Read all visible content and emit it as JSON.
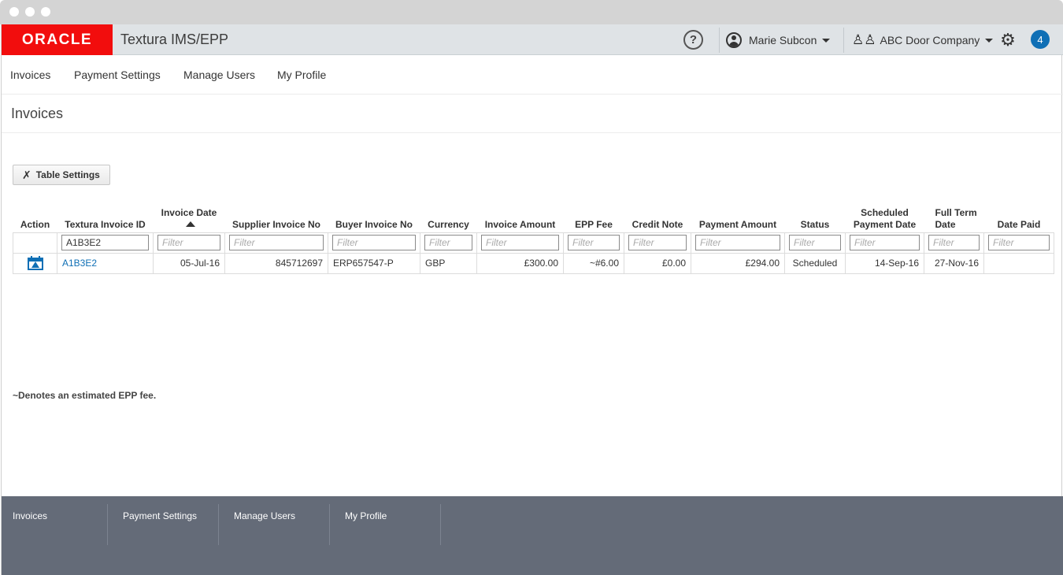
{
  "brand": {
    "logo_text": "ORACLE",
    "app_title": "Textura IMS/EPP",
    "help_label": "?",
    "user_name": "Marie Subcon",
    "company_name": "ABC Door Company",
    "notification_count": "4",
    "brand_color": "#f20d0d"
  },
  "topnav": {
    "items": [
      {
        "label": "Invoices"
      },
      {
        "label": "Payment Settings"
      },
      {
        "label": "Manage Users"
      },
      {
        "label": "My Profile"
      }
    ]
  },
  "page": {
    "title": "Invoices",
    "table_settings_label": "Table Settings"
  },
  "table": {
    "headers": {
      "action": "Action",
      "invoice_id": "Textura Invoice ID",
      "invoice_date": "Invoice Date",
      "supplier_no": "Supplier Invoice No",
      "buyer_no": "Buyer Invoice No",
      "currency": "Currency",
      "invoice_amount": "Invoice Amount",
      "epp_fee": "EPP Fee",
      "credit_note": "Credit Note",
      "payment_amount": "Payment Amount",
      "status": "Status",
      "scheduled_line1": "Scheduled",
      "scheduled_line2": "Payment Date",
      "fullterm_line1": "Full Term",
      "fullterm_line2": "Date",
      "date_paid": "Date Paid"
    },
    "sort": {
      "column": "Invoice Date",
      "direction": "ascending"
    },
    "filters": {
      "placeholder": "Filter",
      "invoice_id_value": "A1B3E2"
    },
    "rows": [
      {
        "invoice_id": "A1B3E2",
        "invoice_date": "05-Jul-16",
        "supplier_no": "845712697",
        "buyer_no": "ERP657547-P",
        "currency": "GBP",
        "invoice_amount": "£300.00",
        "epp_fee": "~#6.00",
        "credit_note": "£0.00",
        "payment_amount": "£294.00",
        "status": "Scheduled",
        "scheduled_payment_date": "14-Sep-16",
        "full_term_date": "27-Nov-16",
        "date_paid": ""
      }
    ]
  },
  "footnote": "~Denotes an estimated EPP fee.",
  "footer": {
    "items": [
      {
        "label": "Invoices"
      },
      {
        "label": "Payment Settings"
      },
      {
        "label": "Manage Users"
      },
      {
        "label": "My Profile"
      }
    ]
  },
  "colors": {
    "accent": "#0f6fb5",
    "footer_bg": "#646b78"
  },
  "icons": {
    "help": "help-icon",
    "user": "user-icon",
    "company": "group-icon",
    "settings": "gear-icon",
    "table_settings": "tools-icon",
    "row_action": "calendar-icon",
    "sort": "sort-ascending-icon"
  }
}
